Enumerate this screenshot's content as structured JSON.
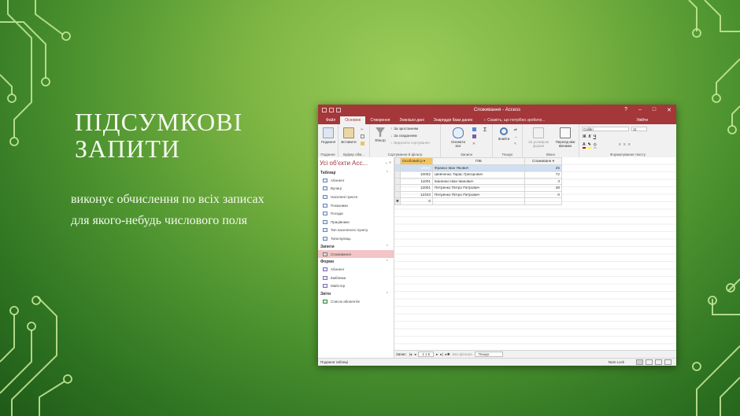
{
  "slide": {
    "title_lines": [
      "ПІДСУМКОВІ",
      "ЗАПИТИ"
    ],
    "body_lines": [
      "виконує обчислення по всіх записах",
      "для якого-небудь числового поля"
    ]
  },
  "window": {
    "title": "Споживання - Access",
    "controls": [
      "?",
      "–",
      "□",
      "✕"
    ]
  },
  "ribbon_tabs": [
    "Файл",
    "Основне",
    "Створення",
    "Зовнішні дані",
    "Знаряддя бази даних"
  ],
  "active_tab": "Основне",
  "tell_me": "♀ Скажіть, що потрібно зробити...",
  "user": "Увійти",
  "ribbon": {
    "view_label": "Подання",
    "paste_label": "Вставити",
    "filter_label": "Фільтр",
    "sort_asc": "За зростанням",
    "sort_desc": "За спаданням",
    "remove_sort": "Видалити сортування",
    "refresh_label": "Оновити все",
    "find_label": "Знайти",
    "size_to_fit": "За розміром форми",
    "switch_windows": "Перехід між вікнами",
    "font_name": "Calibri",
    "font_size": "11",
    "groups": {
      "views": "Подання",
      "clipboard": "Буфер обм...",
      "sort_filter": "Сортування й фільтр",
      "records": "Записи",
      "find": "Пошук",
      "window": "Вікно",
      "text_format": "Форматування тексту"
    }
  },
  "nav": {
    "header": "Усі об'єкти Acc...",
    "sections": [
      {
        "title": "Таблиці",
        "kind": "table",
        "items": [
          "Абонент",
          "Вулиці",
          "Населені пункти",
          "Показники",
          "Посади",
          "Працівники",
          "Тип населеного пункту",
          "Типи вулиць"
        ]
      },
      {
        "title": "Запити",
        "kind": "query",
        "items": [
          "Споживання"
        ]
      },
      {
        "title": "Форми",
        "kind": "form",
        "items": [
          "Абонент",
          "Емблема",
          "Майстер"
        ]
      },
      {
        "title": "Звіти",
        "kind": "report",
        "items": [
          "Список абонентів"
        ]
      }
    ],
    "selected": "Споживання"
  },
  "datasheet": {
    "columns": [
      "Особовий р ▾",
      "ПІБ",
      "Споживанн ▾"
    ],
    "rows": [
      [
        "10001",
        "Франко Іван Якович",
        "25"
      ],
      [
        "10002",
        "Шевченко Тарас Григорович",
        "72"
      ],
      [
        "11001",
        "Іваненко Іван Іванович",
        "3"
      ],
      [
        "12001",
        "Петренко Петро Петрович",
        "48"
      ],
      [
        "12343",
        "Петренко Петро Петрович",
        "0"
      ]
    ],
    "new_row_marker": "✱",
    "new_row_value": "0"
  },
  "record_nav": {
    "label": "Запис:",
    "position": "1 з 5",
    "filter": "Без фільтра",
    "search": "Пошук"
  },
  "status": {
    "left": "Подання таблиці",
    "numlock": "Num Lock"
  },
  "colors": {
    "access_red": "#a4373a",
    "sort_header": "#f5c45c",
    "selected_nav": "#f3c5c6"
  }
}
